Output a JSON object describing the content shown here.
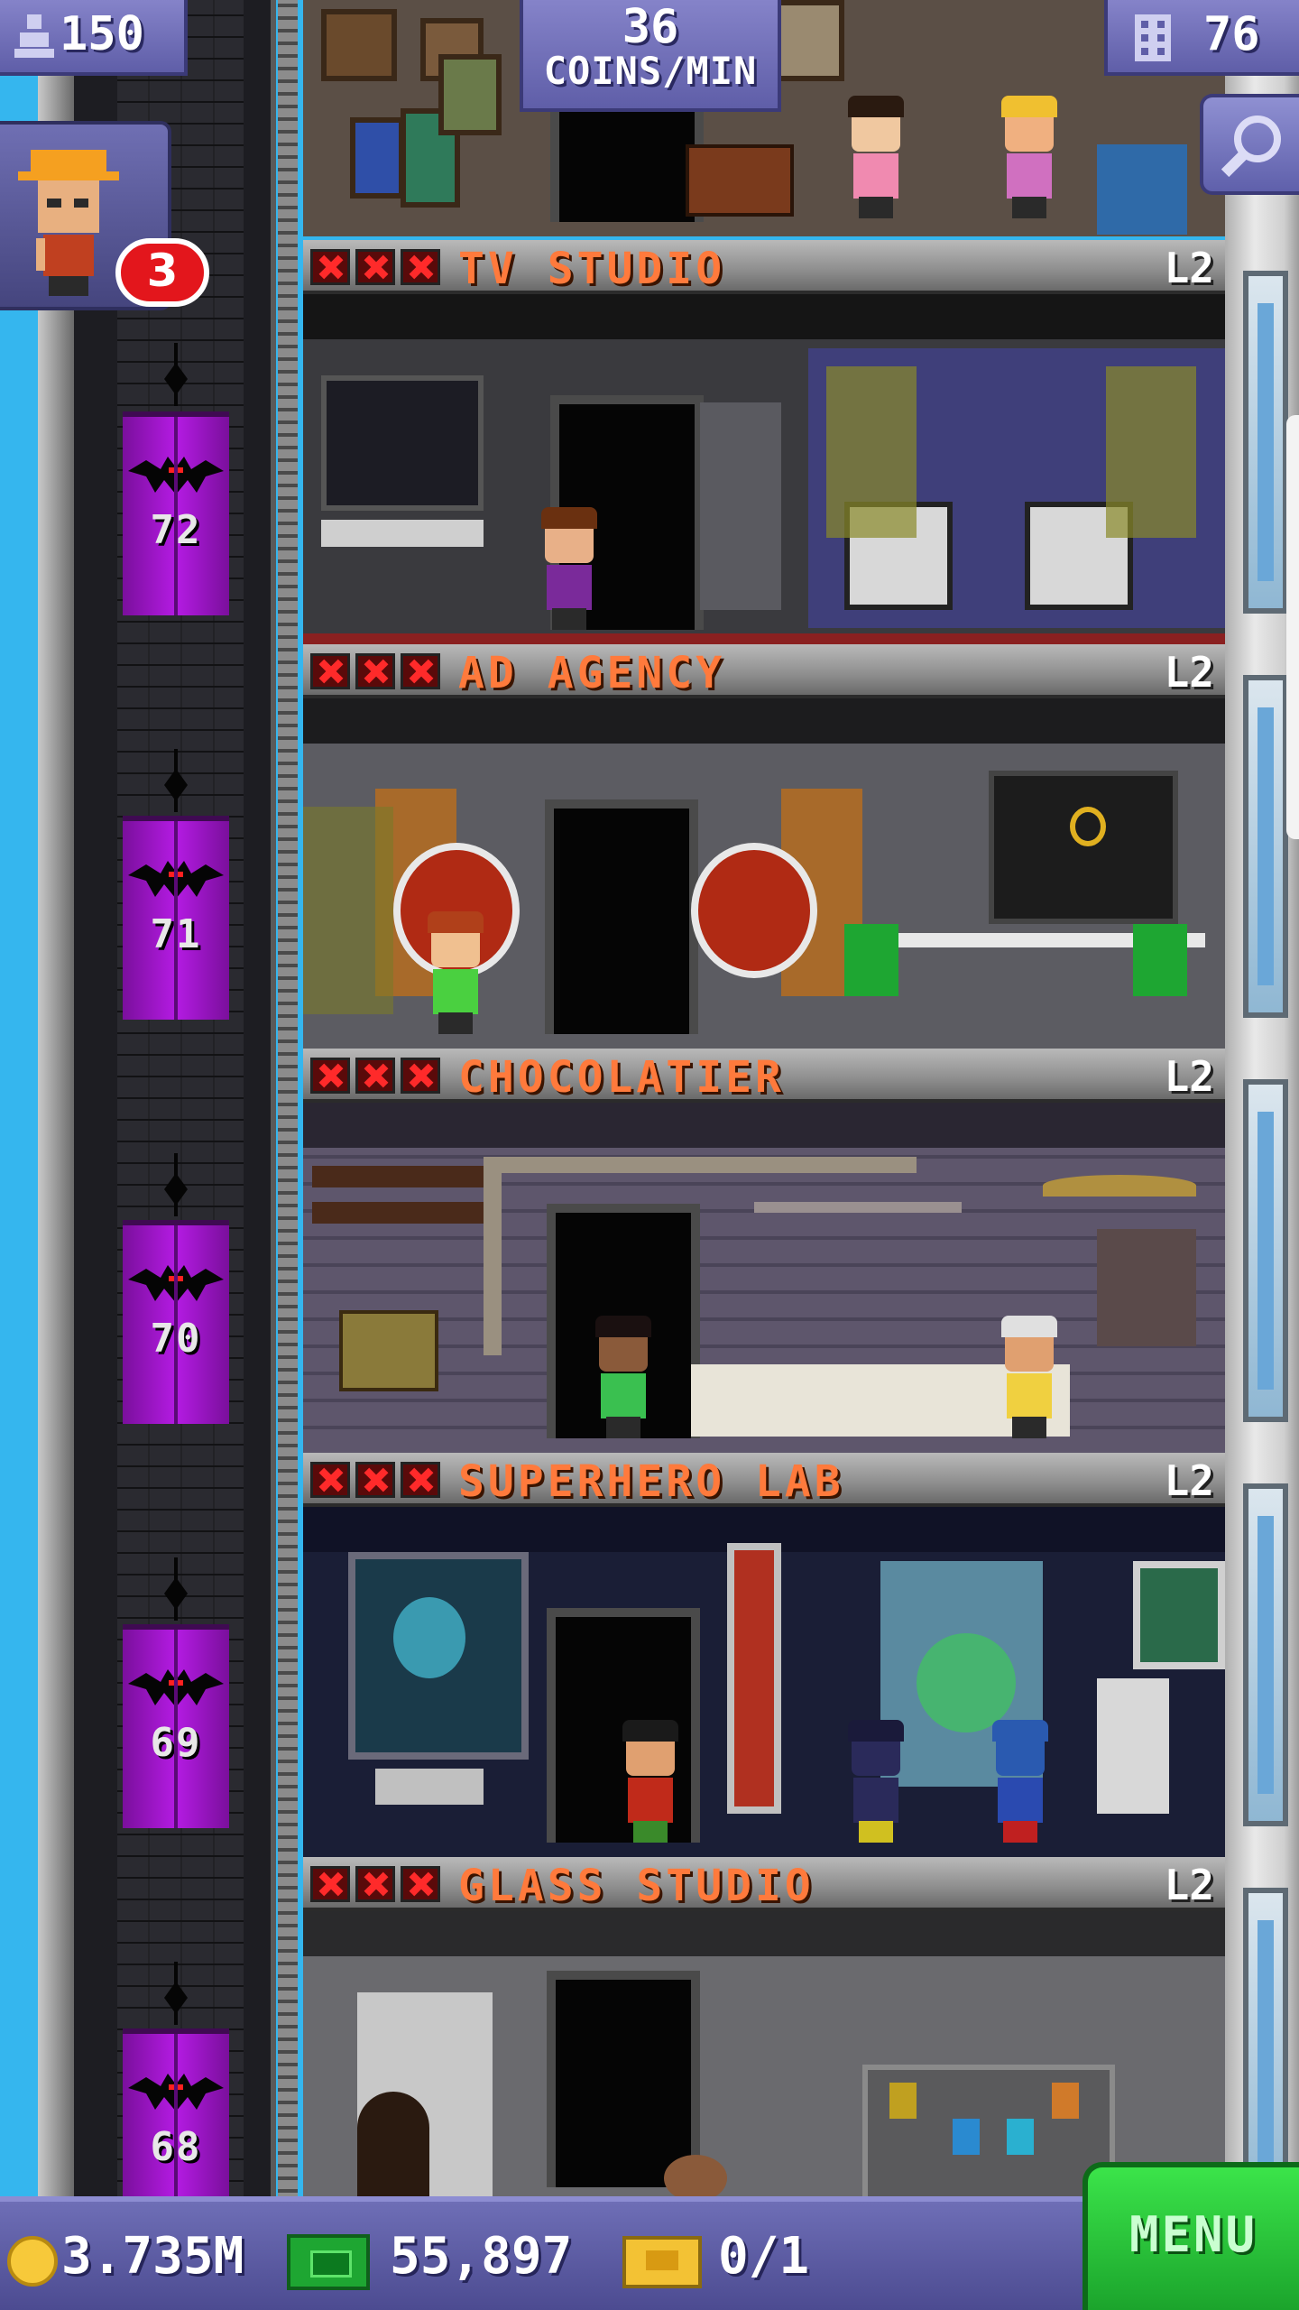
{
  "hud": {
    "population": "150",
    "coins_per_min_value": "36",
    "coins_per_min_unit": "COINS/MIN",
    "floors_count": "76",
    "alert_badge_count": "3"
  },
  "tower_floors": [
    {
      "name": "TV STUDIO",
      "level": "L2",
      "elevator_floor": "72"
    },
    {
      "name": "AD AGENCY",
      "level": "L2",
      "elevator_floor": "71"
    },
    {
      "name": "CHOCOLATIER",
      "level": "L2",
      "elevator_floor": "70"
    },
    {
      "name": "SUPERHERO LAB",
      "level": "L2",
      "elevator_floor": "69"
    },
    {
      "name": "GLASS STUDIO",
      "level": "L2",
      "elevator_floor": "68"
    }
  ],
  "bottom_bar": {
    "coins": "3.735M",
    "tower_bux": "55,897",
    "vip_tickets": "0/1",
    "menu_label": "MENU"
  },
  "colors": {
    "sky": "#35b6ee",
    "elevator": "#b41be3",
    "floor_name": "#ff7a3c",
    "menu": "#2fd43e",
    "hud": "#6f6eb8"
  },
  "icons": [
    "person-icon",
    "building-icon",
    "search-icon",
    "worker-icon",
    "bat-icon",
    "coin-icon",
    "bux-icon",
    "ticket-icon",
    "x-mark-icon"
  ]
}
